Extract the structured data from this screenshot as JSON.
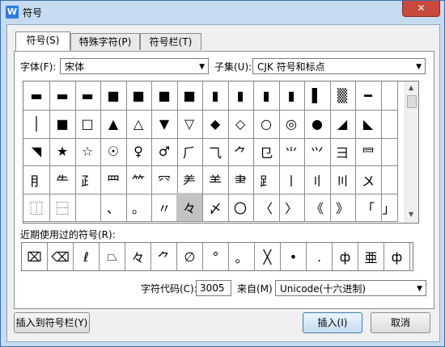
{
  "window": {
    "title": "符号",
    "app_icon": "W",
    "close_label": "✕"
  },
  "tabs": [
    {
      "label": "符号(S)"
    },
    {
      "label": "特殊字符(P)"
    },
    {
      "label": "符号栏(T)"
    }
  ],
  "font": {
    "label": "字体(F):",
    "value": "宋体"
  },
  "subset": {
    "label": "子集(U):",
    "value": "CJK 符号和标点"
  },
  "symbol_rows": [
    [
      "▬",
      "▬",
      "▬",
      "■",
      "■",
      "■",
      "■",
      "▮",
      "▮",
      "▮",
      "▮",
      "▌",
      "▒",
      "━"
    ],
    [
      "│",
      "■",
      "□",
      "▲",
      "△",
      "▼",
      "▽",
      "◆",
      "◇",
      "○",
      "◎",
      "●",
      "◢",
      "◣"
    ],
    [
      "◥",
      "★",
      "☆",
      "☉",
      "♀",
      "♂",
      "⺁",
      "⺄",
      "⺈",
      "⺋",
      "⺌",
      "⺍",
      "⺕",
      "⺜"
    ],
    [
      "⺝",
      "⺧",
      "⺪",
      "⺫",
      "⺮",
      "⺳",
      "⺶",
      "⺷",
      "⺻",
      "⻊",
      "〡",
      "〢",
      "〣",
      "〤"
    ],
    [
      "⿰",
      "⿱",
      "　",
      "、",
      "。",
      "〃",
      "々",
      "〆",
      "〇",
      "〈",
      "〉",
      "《",
      "》",
      "「"
    ]
  ],
  "symbol_rows_last_col": [
    "",
    "",
    "",
    "",
    "」"
  ],
  "selected": {
    "row": 4,
    "col": 6
  },
  "recent": {
    "label": "近期使用过的符号(R):",
    "items": [
      "⌧",
      "⌫",
      "ℓ",
      "⏢",
      "々",
      "⺈",
      "∅",
      "°",
      "。",
      "╳",
      "•",
      ".",
      "ф",
      "亜",
      "ф"
    ]
  },
  "code": {
    "label": "字符代码(C):",
    "value": "3005"
  },
  "from": {
    "label": "来自(M)",
    "value": "Unicode(十六进制)"
  },
  "buttons": {
    "insert_bar": "插入到符号栏(Y)",
    "insert": "插入(I)",
    "cancel": "取消"
  }
}
